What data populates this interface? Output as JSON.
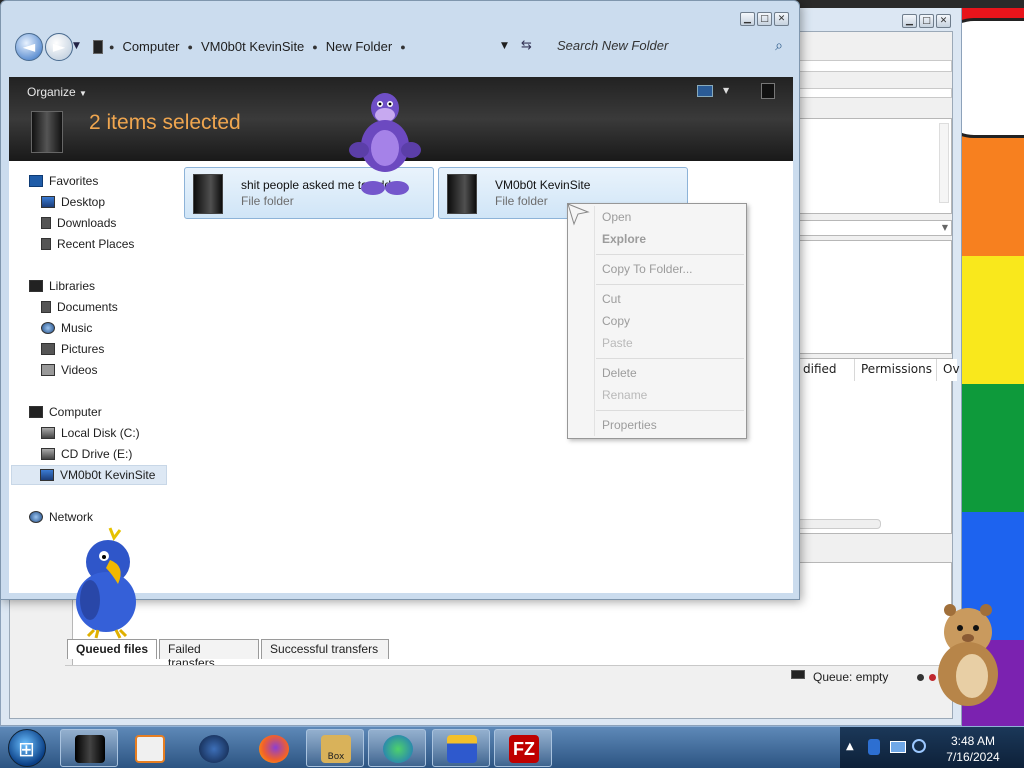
{
  "explorer": {
    "breadcrumbs": [
      "Computer",
      "VM0b0t KevinSite",
      "New Folder"
    ],
    "search_placeholder": "Search New Folder",
    "organize_label": "Organize",
    "selection_info": "2 items selected",
    "nav": {
      "favorites": {
        "label": "Favorites",
        "items": [
          "Desktop",
          "Downloads",
          "Recent Places"
        ]
      },
      "libraries": {
        "label": "Libraries",
        "items": [
          "Documents",
          "Music",
          "Pictures",
          "Videos"
        ]
      },
      "computer": {
        "label": "Computer",
        "items": [
          "Local Disk (C:)",
          "CD Drive (E:)",
          "VM0b0t KevinSite"
        ]
      },
      "network": {
        "label": "Network"
      }
    },
    "files": [
      {
        "name": "shit people asked me to add",
        "type": "File folder"
      },
      {
        "name": "VM0b0t KevinSite",
        "type": "File folder"
      }
    ]
  },
  "context_menu": {
    "items": [
      "Open",
      "Explore",
      "Copy To Folder...",
      "Cut",
      "Copy",
      "Paste",
      "Delete",
      "Rename",
      "Properties"
    ]
  },
  "filezilla": {
    "columns": [
      "dified",
      "Permissions",
      "Ov"
    ],
    "tabs": [
      "Queued files",
      "Failed transfers",
      "Successful transfers"
    ],
    "queue_status": "Queue: empty"
  },
  "taskbar": {
    "time": "3:48 AM",
    "date": "7/16/2024",
    "fz_label": "FZ",
    "box_label": "Box"
  }
}
